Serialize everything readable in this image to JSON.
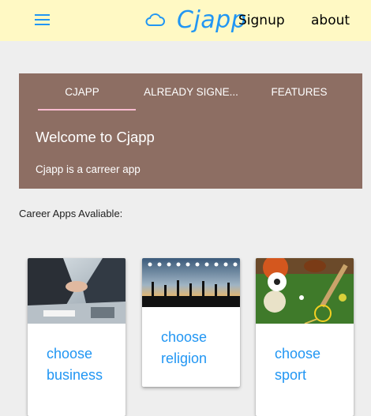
{
  "navbar": {
    "menu_icon": "hamburger-menu-icon",
    "cloud_icon": "cloud-icon",
    "brand": "Cjapp",
    "links": [
      "Signup",
      "about"
    ],
    "bg_color": "#fff9c4",
    "accent_color": "#2196f3"
  },
  "hero": {
    "bg_color": "#8d6e63",
    "tabs": [
      "CJAPP",
      "ALREADY SIGNE...",
      "FEATURES"
    ],
    "active_tab": 0,
    "title": "Welcome to Cjapp",
    "subtitle": "Cjapp is a carreer app"
  },
  "section_label": "Career Apps Avaliable:",
  "cards": [
    {
      "link": "choose business",
      "image": "business-handshake-photo"
    },
    {
      "link": "choose religion",
      "image": "religion-silhouettes-photo"
    },
    {
      "link": "choose sport",
      "image": "sports-balls-photo"
    }
  ]
}
